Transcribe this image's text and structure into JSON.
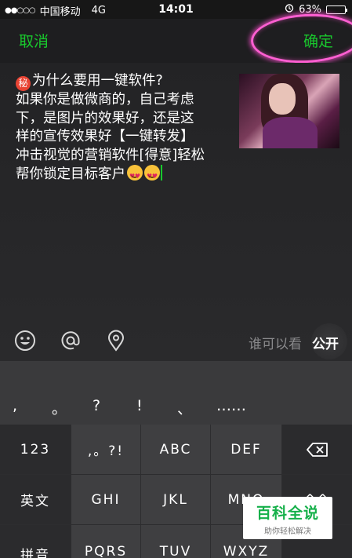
{
  "status_bar": {
    "signal": "●●○○○",
    "carrier": "中国移动",
    "network": "4G",
    "time": "14:01",
    "battery_percent": "63%",
    "battery_level": 0.63
  },
  "nav": {
    "cancel_label": "取消",
    "confirm_label": "确定"
  },
  "post": {
    "badge": "秘",
    "lines": [
      "为什么要用一键软件?",
      "如果你是做微商的，自己考虑",
      "下，是图片的效果好，还是这",
      "样的宣传效果好【一键转发】",
      "冲击视觉的营销软件[得意]轻松",
      "帮你锁定目标客户"
    ]
  },
  "toolbar": {
    "visibility_label": "谁可以看",
    "visibility_value": "公开"
  },
  "keyboard": {
    "punctuation": [
      ",",
      "。",
      "?",
      "!",
      "、",
      "……"
    ],
    "rows": [
      [
        "123",
        ",。?!",
        "ABC",
        "DEF",
        "⌫"
      ],
      [
        "英文",
        "GHI",
        "JKL",
        "MNO",
        "^^"
      ],
      [
        "拼音",
        "PQRS",
        "TUV",
        "WXYZ",
        ""
      ]
    ]
  },
  "watermark": {
    "title": "百科全说",
    "subtitle": "助你轻松解决"
  },
  "colors": {
    "accent": "#19c92d",
    "highlight": "#ff5fd2"
  }
}
